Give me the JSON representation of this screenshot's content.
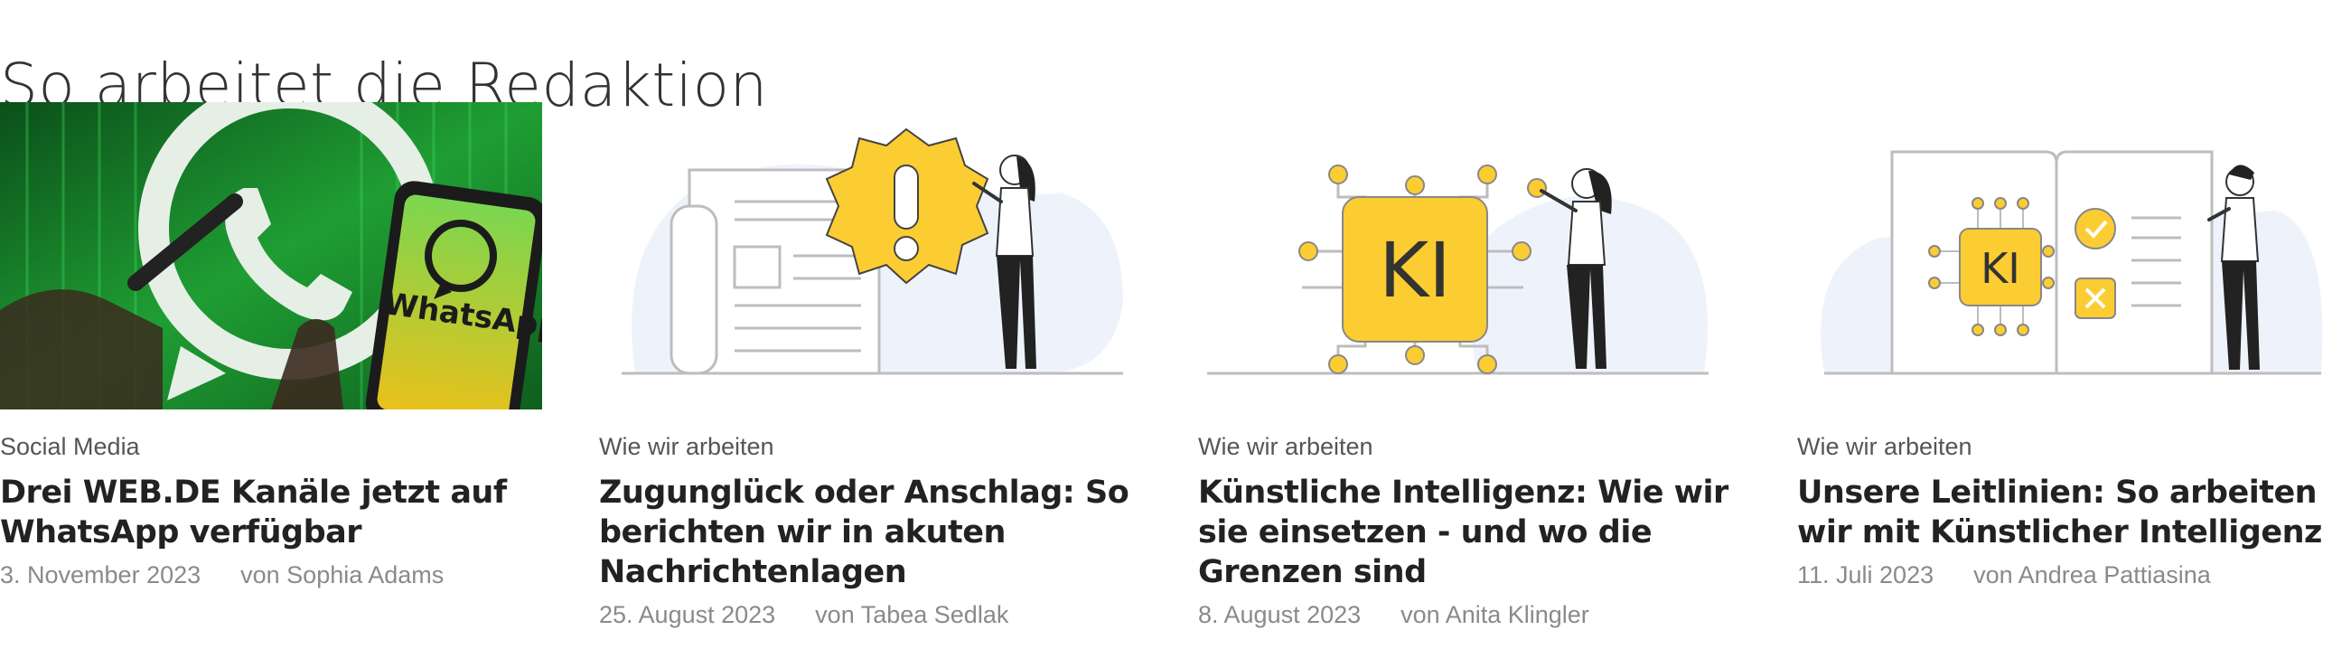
{
  "section": {
    "title": "So arbeitet die Redaktion"
  },
  "cards": [
    {
      "image_icon": "whatsapp-photo",
      "image_text": "WhatsApp",
      "kicker": "Social Media",
      "headline": "Drei WEB.DE Kanäle jetzt auf WhatsApp verfügbar",
      "date": "3. November 2023",
      "author": "von Sophia Adams"
    },
    {
      "image_icon": "newspaper-alert-illustration",
      "kicker": "Wie wir arbeiten",
      "headline": "Zugunglück oder Anschlag: So berichten wir in akuten Nachrichtenlagen",
      "date": "25. August 2023",
      "author": "von Tabea Sedlak"
    },
    {
      "image_icon": "ai-chip-illustration",
      "image_text": "KI",
      "kicker": "Wie wir arbeiten",
      "headline": "Künstliche Intelligenz: Wie wir sie einsetzen - und wo die Grenzen sind",
      "date": "8. August 2023",
      "author": "von Anita Klingler"
    },
    {
      "image_icon": "guidelines-book-illustration",
      "image_text": "KI",
      "kicker": "Wie wir arbeiten",
      "headline": "Unsere Leitlinien: So arbeiten wir mit Künstlicher Intelligenz",
      "date": "11. Juli 2023",
      "author": "von Andrea Pattiasina"
    }
  ],
  "colors": {
    "accent_yellow": "#fccd32",
    "whatsapp_green": "#2db742",
    "blob": "#eef3fb",
    "line": "#bdbdbd"
  }
}
